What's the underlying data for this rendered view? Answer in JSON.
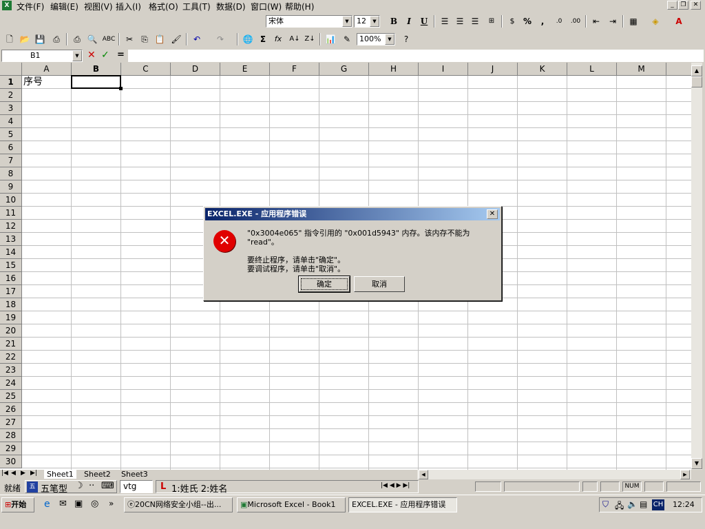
{
  "menubar": {
    "items": [
      "文件(F)",
      "编辑(E)",
      "视图(V)",
      "插入(I)",
      "格式(O)",
      "工具(T)",
      "数据(D)",
      "窗口(W)",
      "帮助(H)"
    ]
  },
  "format_toolbar": {
    "font_name": "宋体",
    "font_size": "12",
    "bold": "B",
    "italic": "I",
    "underline": "U",
    "percent": "%",
    "comma": ","
  },
  "standard_toolbar": {
    "zoom": "100%",
    "sigma": "Σ",
    "fx": "fx"
  },
  "formula_bar": {
    "name_box": "B1",
    "equals": "="
  },
  "columns": [
    "A",
    "B",
    "C",
    "D",
    "E",
    "F",
    "G",
    "H",
    "I",
    "J",
    "K",
    "L",
    "M"
  ],
  "rows": [
    "1",
    "2",
    "3",
    "4",
    "5",
    "6",
    "7",
    "8",
    "9",
    "10",
    "11",
    "12",
    "13",
    "14",
    "15",
    "16",
    "17",
    "18",
    "19",
    "20",
    "21",
    "22",
    "23",
    "24",
    "25",
    "26",
    "27",
    "28",
    "29",
    "30"
  ],
  "cells": {
    "A1": "序号"
  },
  "dialog": {
    "title": "EXCEL.EXE - 应用程序错误",
    "message_line1": "\"0x3004e065\" 指令引用的 \"0x001d5943\" 内存。该内存不能为 \"read\"。",
    "message_line2": "要终止程序，请单击\"确定\"。",
    "message_line3": "要调试程序，请单击\"取消\"。",
    "ok_label": "确定",
    "cancel_label": "取消"
  },
  "sheet_tabs": [
    "Sheet1",
    "Sheet2",
    "Sheet3"
  ],
  "status_bar": {
    "ready": "就绪",
    "ime_name": "五笔型",
    "ime_extra": "vtg",
    "ime_candidates": "1:姓氏 2:姓名",
    "num": "NUM"
  },
  "taskbar": {
    "start": "开始",
    "buttons": [
      "20CN网络安全小组--出...",
      "Microsoft Excel - Book1",
      "EXCEL.EXE - 应用程序错误"
    ],
    "tray_ime": "CH",
    "clock": "12:24"
  }
}
